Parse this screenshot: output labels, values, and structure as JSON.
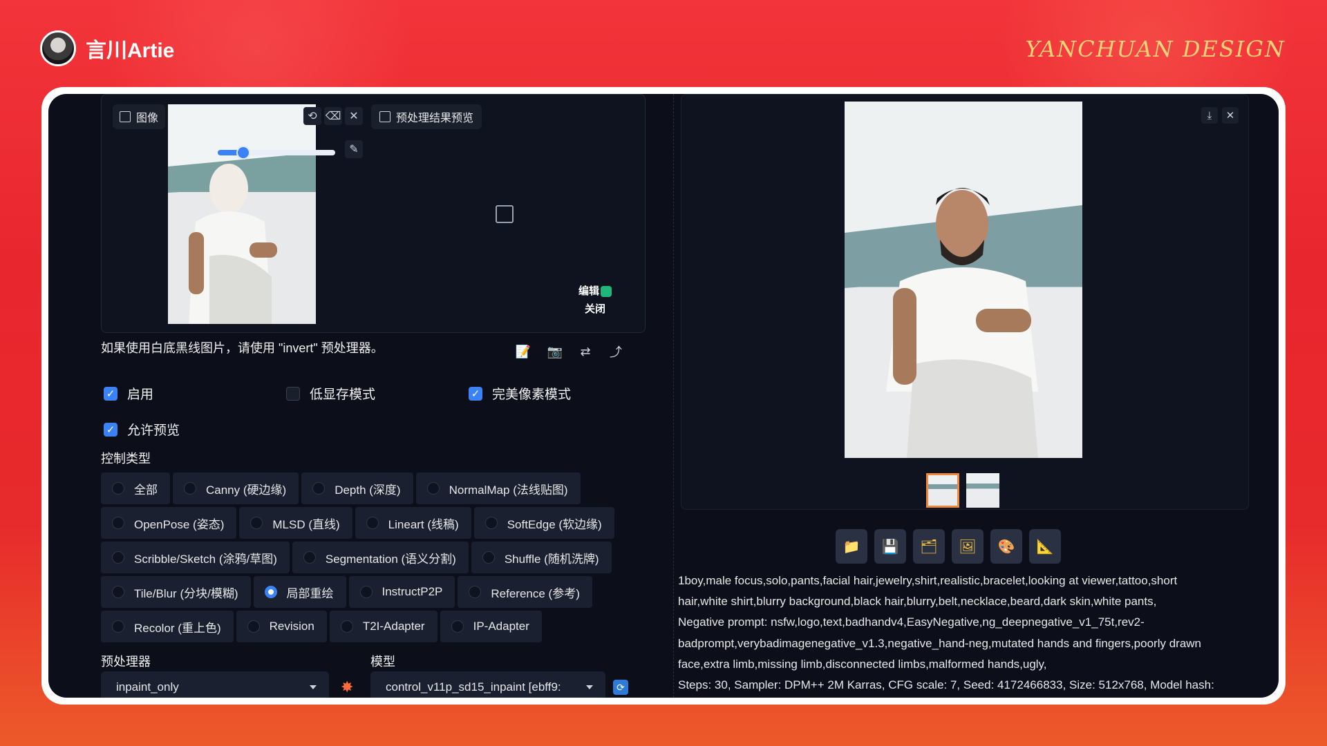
{
  "brand": {
    "name": "言川Artie",
    "design": "YANCHUAN DESIGN"
  },
  "image_panel": {
    "tab_image": "图像",
    "tab_preview": "预处理结果预览",
    "edit_label": "编辑",
    "close_label": "关闭",
    "brush_slider_value": 0.22,
    "hint": "如果使用白底黑线图片，请使用 \"invert\" 预处理器。"
  },
  "options": {
    "enable": "启用",
    "low_vram": "低显存模式",
    "pixel_perfect": "完美像素模式",
    "allow_preview": "允许预览"
  },
  "control_type": {
    "label": "控制类型",
    "rows": [
      [
        "全部",
        "Canny (硬边缘)",
        "Depth (深度)",
        "NormalMap (法线贴图)"
      ],
      [
        "OpenPose (姿态)",
        "MLSD (直线)",
        "Lineart (线稿)",
        "SoftEdge (软边缘)"
      ],
      [
        "Scribble/Sketch (涂鸦/草图)",
        "Segmentation (语义分割)",
        "Shuffle (随机洗牌)"
      ],
      [
        "Tile/Blur (分块/模糊)",
        "局部重绘",
        "InstructP2P",
        "Reference (参考)"
      ],
      [
        "Recolor (重上色)",
        "Revision",
        "T2I-Adapter",
        "IP-Adapter"
      ]
    ],
    "selected": "局部重绘"
  },
  "preprocessor": {
    "label": "预处理器",
    "value": "inpaint_only"
  },
  "model": {
    "label": "模型",
    "value": "control_v11p_sd15_inpaint [ebff9:"
  },
  "generation_info": [
    "1boy,male focus,solo,pants,facial hair,jewelry,shirt,realistic,bracelet,looking at viewer,tattoo,short",
    "hair,white shirt,blurry background,black hair,blurry,belt,necklace,beard,dark skin,white pants,",
    "Negative prompt: nsfw,logo,text,badhandv4,EasyNegative,ng_deepnegative_v1_75t,rev2-",
    "badprompt,verybadimagenegative_v1.3,negative_hand-neg,mutated hands and fingers,poorly drawn",
    "face,extra limb,missing limb,disconnected limbs,malformed hands,ugly,",
    "Steps: 30, Sampler: DPM++ 2M Karras, CFG scale: 7, Seed: 4172466833, Size: 512x768, Model hash:"
  ],
  "icons": {
    "action_buttons": [
      "folder-icon",
      "save-icon",
      "zip-icon",
      "image-icon",
      "palette-icon",
      "ruler-icon"
    ]
  }
}
